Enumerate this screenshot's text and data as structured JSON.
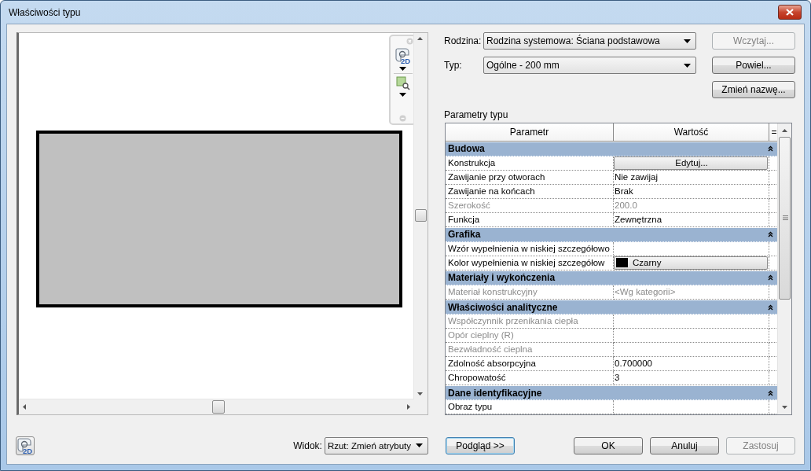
{
  "window": {
    "title": "Właściwości typu"
  },
  "navigation_bar": {
    "wheel_label": "2D"
  },
  "view_wheel_button": {
    "label": "2D"
  },
  "family": {
    "label": "Rodzina:",
    "value": "Rodzina systemowa: Ściana podstawowa"
  },
  "type": {
    "label": "Typ:",
    "value": "Ogólne - 200 mm"
  },
  "side_buttons": [
    {
      "label": "Wczytaj...",
      "disabled": true
    },
    {
      "label": "Powiel...",
      "disabled": false
    },
    {
      "label": "Zmień nazwę...",
      "disabled": false
    }
  ],
  "parameters": {
    "title": "Parametry typu",
    "columns": [
      "Parametr",
      "Wartość",
      "="
    ],
    "groups": [
      {
        "name": "Budowa",
        "expanded": true,
        "rows": [
          {
            "name": "Konstrukcja",
            "value": "Edytuj...",
            "kind": "button",
            "disabled": false
          },
          {
            "name": "Zawijanie przy otworach",
            "value": "Nie zawijaj",
            "kind": "text",
            "disabled": false
          },
          {
            "name": "Zawijanie na końcach",
            "value": "Brak",
            "kind": "text",
            "disabled": false
          },
          {
            "name": "Szerokość",
            "value": "200.0",
            "kind": "text",
            "disabled": true
          },
          {
            "name": "Funkcja",
            "value": "Zewnętrzna",
            "kind": "text",
            "disabled": false
          }
        ]
      },
      {
        "name": "Grafika",
        "expanded": true,
        "rows": [
          {
            "name": "Wzór wypełnienia w niskiej szczegółowo",
            "kind": "text",
            "disabled": false
          },
          {
            "name": "Kolor wypełnienia w niskiej szczegółow",
            "value": "Czarny",
            "kind": "color",
            "disabled": false
          }
        ]
      },
      {
        "name": "Materiały i wykończenia",
        "expanded": true,
        "rows": [
          {
            "name": "Materiał konstrukcyjny",
            "value": "<Wg kategorii>",
            "kind": "text",
            "disabled": true
          }
        ]
      },
      {
        "name": "Właściwości analityczne",
        "expanded": true,
        "rows": [
          {
            "name": "Współczynnik przenikania ciepła",
            "kind": "text",
            "disabled": true
          },
          {
            "name": "Opór cieplny (R)",
            "kind": "text",
            "disabled": true
          },
          {
            "name": "Bezwładność cieplna",
            "kind": "text",
            "disabled": true
          },
          {
            "name": "Zdolność absorpcyjna",
            "value": "0.700000",
            "kind": "text",
            "disabled": false
          },
          {
            "name": "Chropowatość",
            "value": "3",
            "kind": "text",
            "disabled": false
          }
        ]
      },
      {
        "name": "Dane identyfikacyjne",
        "expanded": true,
        "rows": [
          {
            "name": "Obraz typu",
            "kind": "text",
            "disabled": false
          }
        ]
      }
    ]
  },
  "view": {
    "label": "Widok:",
    "value": "Rzut: Zmień atrybuty"
  },
  "preview_button": {
    "label": "Podgląd >>"
  },
  "buttons": [
    {
      "label": "OK",
      "disabled": false
    },
    {
      "label": "Anuluj",
      "disabled": false
    },
    {
      "label": "Zastosuj",
      "disabled": true
    }
  ]
}
